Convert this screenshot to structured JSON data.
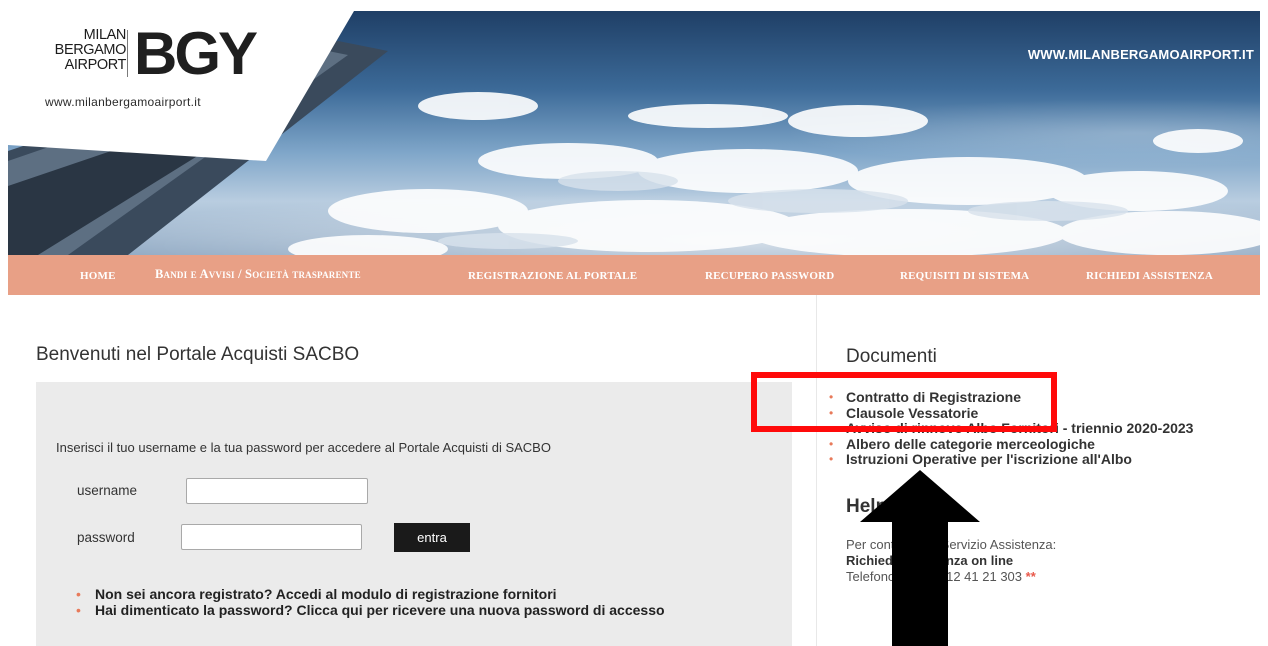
{
  "header": {
    "site_url": "WWW.MILANBERGAMOAIRPORT.IT",
    "logo": {
      "city_lines": [
        "MILAN",
        "BERGAMO",
        "AIRPORT"
      ],
      "code": "BGY",
      "web": "www.milanbergamoairport.it"
    }
  },
  "nav": {
    "items": [
      "HOME",
      "Bandi e Avvisi / Società trasparente",
      "REGISTRAZIONE AL PORTALE",
      "RECUPERO PASSWORD",
      "REQUISITI DI SISTEMA",
      "RICHIEDI ASSISTENZA"
    ],
    "bg_color": "#e8a086"
  },
  "login": {
    "title": "Benvenuti nel Portale Acquisti SACBO",
    "intro": "Inserisci il tuo username e la tua password per accedere al Portale Acquisti di SACBO",
    "username_label": "username",
    "password_label": "password",
    "username_value": "",
    "password_value": "",
    "submit_label": "entra",
    "links": [
      "Non sei ancora registrato? Accedi al modulo di registrazione fornitori",
      "Hai dimenticato la password? Clicca qui per ricevere una nuova password di accesso"
    ]
  },
  "documents": {
    "title": "Documenti",
    "items": [
      "Contratto di Registrazione",
      "Clausole Vessatorie",
      "Avviso di rinnovo Albo Fornitori - triennio 2020-2023",
      "Albero delle categorie merceologiche",
      "Istruzioni Operative per l'iscrizione all'Albo"
    ]
  },
  "help": {
    "title": "Help",
    "line1": "Per contattare il Servizio Assistenza:",
    "line2": "Richiedi Assistenza on line",
    "line3": "Telefono: +39 02 12 41 21 303",
    "line3_mark": "**"
  },
  "annotation": {
    "highlight_color": "#ff0a0a",
    "arrow_color": "#000000"
  }
}
